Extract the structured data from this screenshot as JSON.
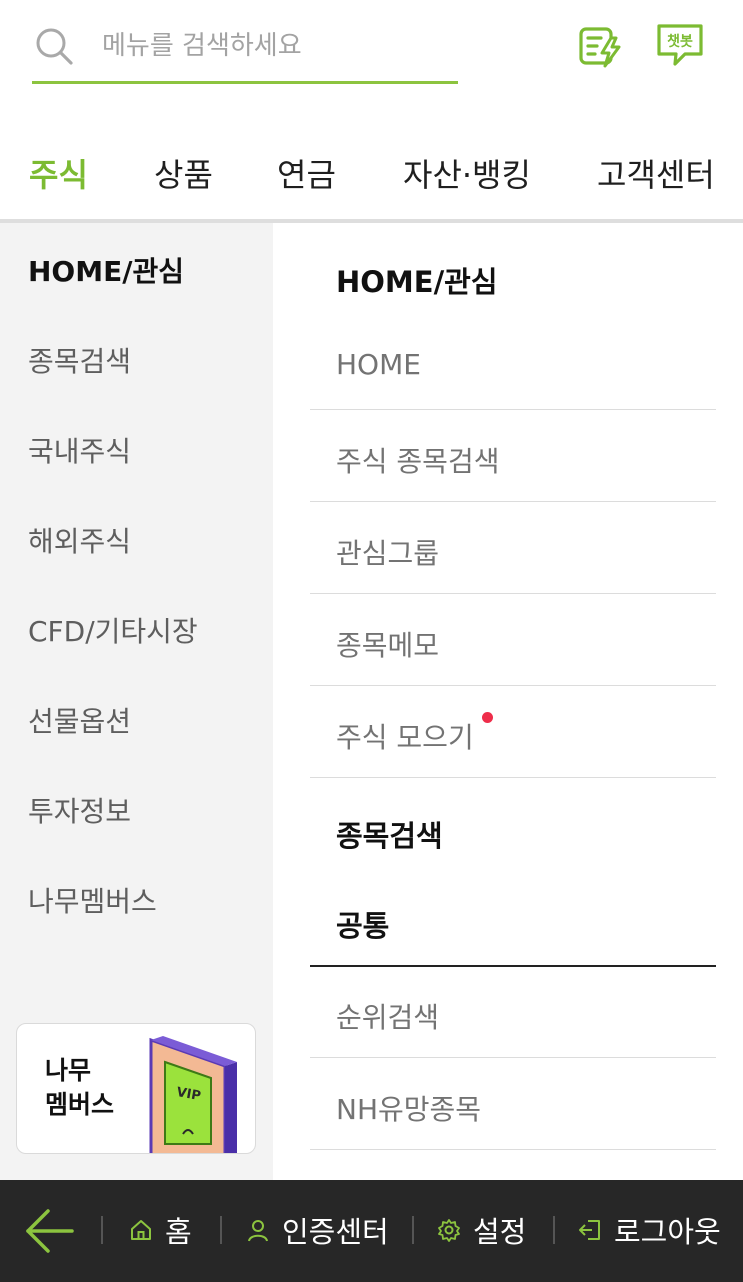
{
  "search": {
    "placeholder": "메뉴를 검색하세요"
  },
  "header_icons": {
    "quick": "quick-menu-icon",
    "chatbot_label": "챗봇"
  },
  "tabs": [
    {
      "label": "주식",
      "active": true
    },
    {
      "label": "상품",
      "active": false
    },
    {
      "label": "연금",
      "active": false
    },
    {
      "label": "자산·뱅킹",
      "active": false
    },
    {
      "label": "고객센터",
      "active": false
    }
  ],
  "sidebar": {
    "items": [
      {
        "label": "HOME/관심",
        "active": true
      },
      {
        "label": "종목검색"
      },
      {
        "label": "국내주식"
      },
      {
        "label": "해외주식"
      },
      {
        "label": "CFD/기타시장"
      },
      {
        "label": "선물옵션"
      },
      {
        "label": "투자정보"
      },
      {
        "label": "나무멤버스"
      }
    ],
    "promo": {
      "line1": "나무",
      "line2": "멤버스",
      "card_text": "VIP"
    }
  },
  "submenu": {
    "sections": [
      {
        "title": "HOME/관심",
        "items": [
          "HOME",
          "주식 종목검색",
          "관심그룹",
          "종목메모",
          "주식 모으기"
        ]
      },
      {
        "title": "종목검색",
        "group": "공통",
        "items": [
          "순위검색",
          "NH유망종목"
        ]
      }
    ]
  },
  "bottom_bar": {
    "home": "홈",
    "auth": "인증센터",
    "settings": "설정",
    "logout": "로그아웃"
  },
  "colors": {
    "accent_green": "#7cbb32",
    "new_dot": "#ee2d4a",
    "bottom_bar": "#272727",
    "sidebar_bg": "#f3f3f3"
  }
}
